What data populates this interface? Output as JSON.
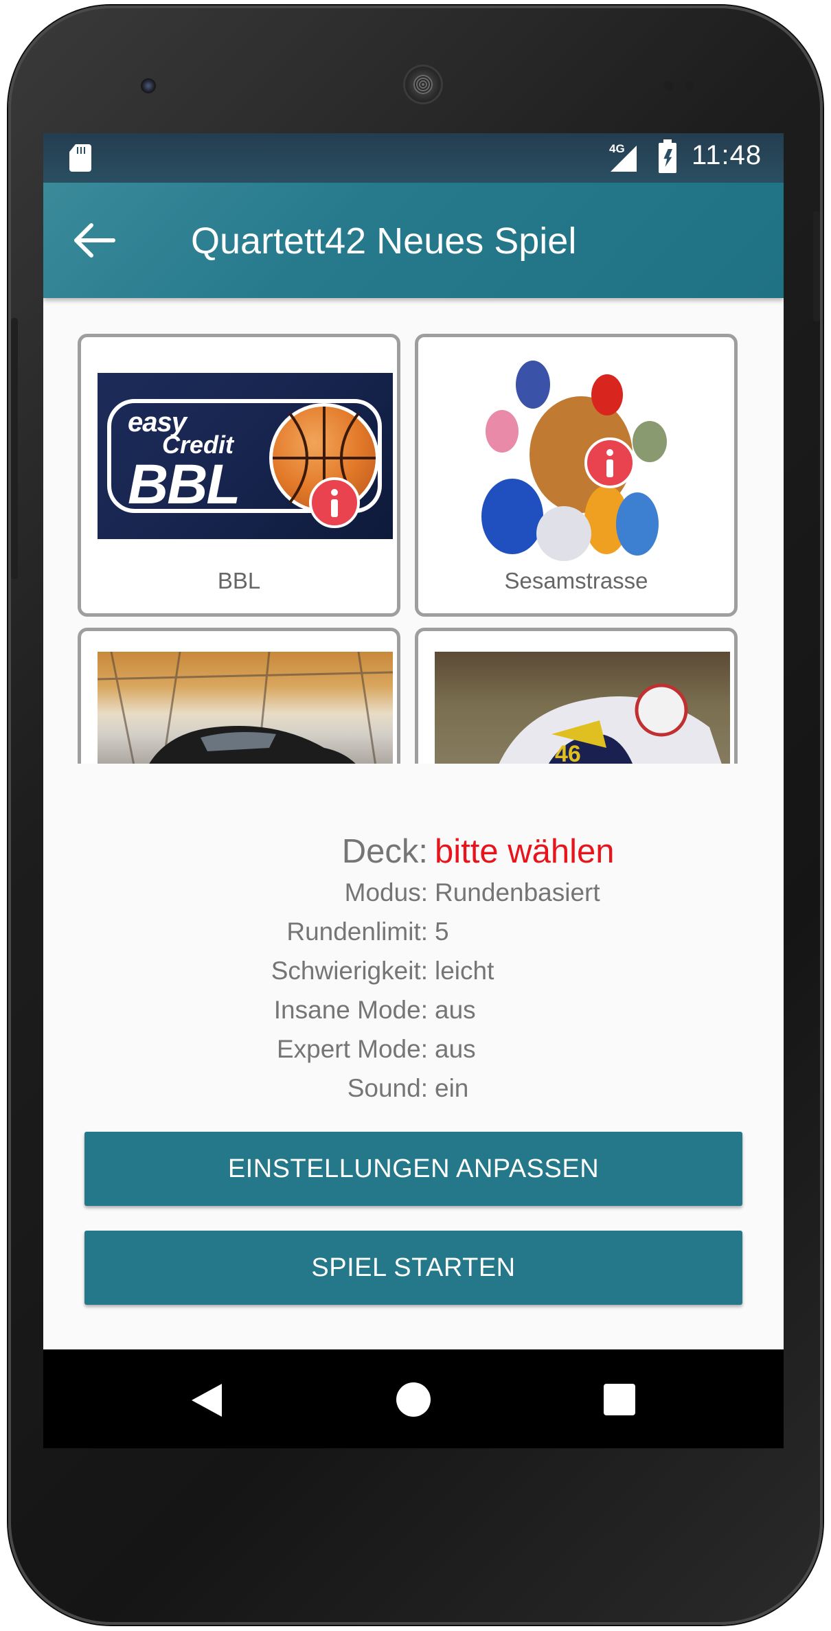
{
  "status_bar": {
    "network": "4G",
    "time": "11:48"
  },
  "app_bar": {
    "title": "Quartett42 Neues Spiel"
  },
  "decks": [
    {
      "label": "BBL",
      "logo_line1": "easy",
      "logo_line2": "Credit",
      "logo_big": "BBL",
      "has_info": true
    },
    {
      "label": "Sesamstrasse",
      "has_info": true
    },
    {
      "label": ""
    },
    {
      "label": ""
    }
  ],
  "summary": {
    "deck": {
      "label": "Deck:",
      "value": "bitte wählen",
      "value_color": "#e8141c"
    },
    "rows": [
      {
        "label": "Modus:",
        "value": "Rundenbasiert"
      },
      {
        "label": "Rundenlimit:",
        "value": "5"
      },
      {
        "label": "Schwierigkeit:",
        "value": "leicht"
      },
      {
        "label": "Insane Mode:",
        "value": "aus"
      },
      {
        "label": "Expert Mode:",
        "value": "aus"
      },
      {
        "label": "Sound:",
        "value": "ein"
      }
    ]
  },
  "buttons": {
    "settings_label": "EINSTELLUNGEN ANPASSEN",
    "start_label": "SPIEL STARTEN"
  },
  "colors": {
    "accent": "#25788a",
    "app_bar": "#267a8c",
    "status_bar": "#243d4f",
    "info_badge": "#e8434f"
  },
  "icons": {
    "back": "arrow-left-icon",
    "info": "info-icon",
    "sd_card": "sd-card-icon",
    "signal": "signal-icon",
    "battery": "battery-charging-icon"
  }
}
